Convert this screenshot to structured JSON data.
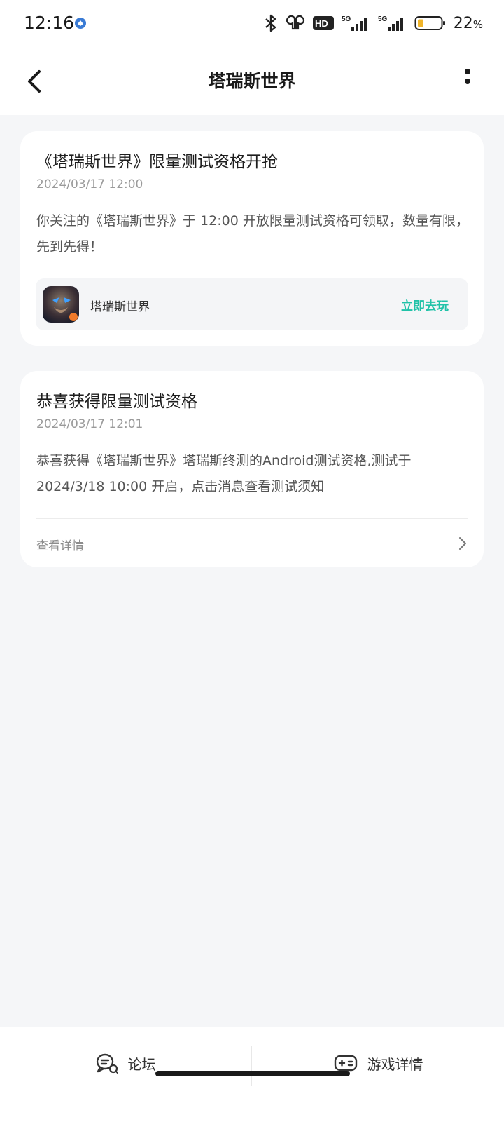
{
  "status_bar": {
    "time": "12:16",
    "battery_percent": "22",
    "battery_unit": "%",
    "network_1": "5G",
    "network_2": "5G",
    "hd_badge": "HD",
    "icons": [
      "bluetooth-icon",
      "earbuds-icon",
      "hd-icon",
      "signal-icon",
      "battery-icon"
    ]
  },
  "header": {
    "title": "塔瑞斯世界"
  },
  "notifications": [
    {
      "title": "《塔瑞斯世界》限量测试资格开抢",
      "time": "2024/03/17 12:00",
      "body": "你关注的《塔瑞斯世界》于 12:00 开放限量测试资格可领取，数量有限，先到先得！",
      "game_name": "塔瑞斯世界",
      "action_label": "立即去玩"
    },
    {
      "title": "恭喜获得限量测试资格",
      "time": "2024/03/17 12:01",
      "body": "恭喜获得《塔瑞斯世界》塔瑞斯终测的Android测试资格,测试于2024/3/18 10:00 开启，点击消息查看测试须知",
      "detail_label": "查看详情"
    }
  ],
  "bottom_bar": {
    "forum_label": "论坛",
    "game_detail_label": "游戏详情"
  },
  "colors": {
    "accent": "#20c2a8",
    "background": "#f5f6f8",
    "card": "#ffffff"
  }
}
